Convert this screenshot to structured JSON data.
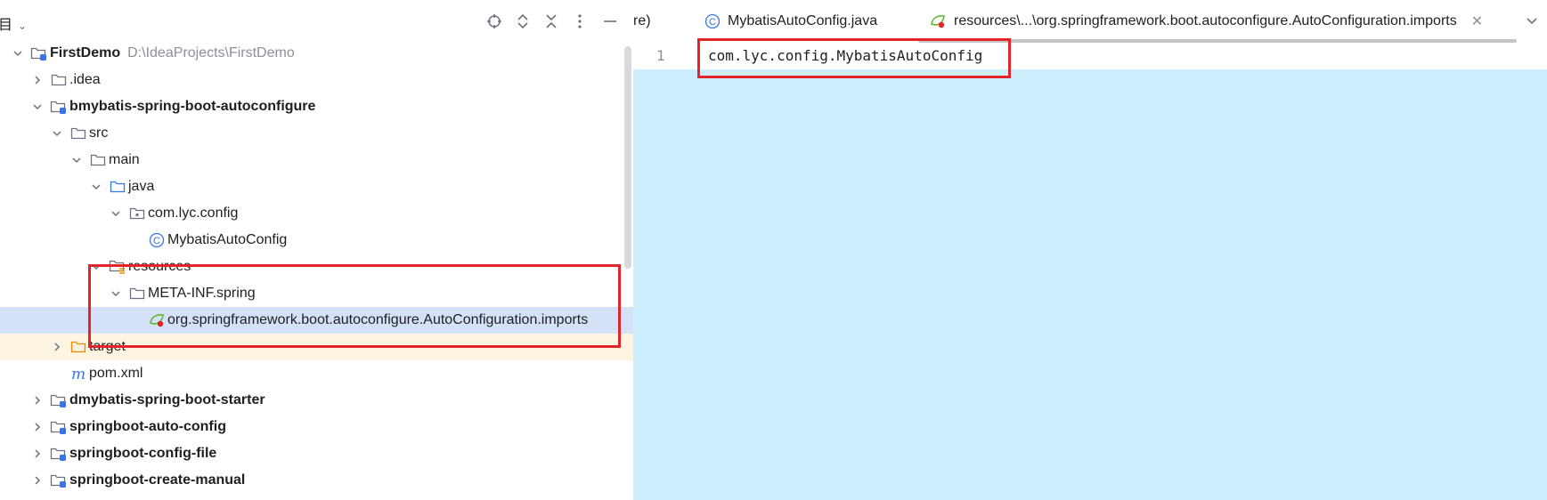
{
  "project_panel": {
    "title": "目",
    "tree": [
      {
        "label": "FirstDemo",
        "path": "D:\\IdeaProjects\\FirstDemo",
        "icon": "module-folder-icon",
        "level": 0,
        "expanded": true
      },
      {
        "label": ".idea",
        "icon": "folder-icon",
        "level": 1,
        "expanded": false
      },
      {
        "label": "bmybatis-spring-boot-autoconfigure",
        "icon": "module-folder-icon",
        "level": 1,
        "expanded": true
      },
      {
        "label": "src",
        "icon": "folder-icon",
        "level": 2,
        "expanded": true
      },
      {
        "label": "main",
        "icon": "folder-icon",
        "level": 3,
        "expanded": true
      },
      {
        "label": "java",
        "icon": "source-folder-icon",
        "level": 4,
        "expanded": true
      },
      {
        "label": "com.lyc.config",
        "icon": "package-icon",
        "level": 5,
        "expanded": true
      },
      {
        "label": "MybatisAutoConfig",
        "icon": "java-class-icon",
        "level": 6
      },
      {
        "label": "resources",
        "icon": "resources-folder-icon",
        "level": 4,
        "expanded": true
      },
      {
        "label": "META-INF.spring",
        "icon": "folder-icon",
        "level": 5,
        "expanded": true
      },
      {
        "label": "org.springframework.boot.autoconfigure.AutoConfiguration.imports",
        "icon": "spring-imports-icon",
        "level": 6,
        "selected": true
      },
      {
        "label": "target",
        "icon": "excluded-folder-icon",
        "level": 2,
        "expanded": false,
        "highlighted": true
      },
      {
        "label": "pom.xml",
        "icon": "maven-icon",
        "level": 2
      },
      {
        "label": "dmybatis-spring-boot-starter",
        "icon": "module-folder-icon",
        "level": 1,
        "expanded": false
      },
      {
        "label": "springboot-auto-config",
        "icon": "module-folder-icon",
        "level": 1,
        "expanded": false
      },
      {
        "label": "springboot-config-file",
        "icon": "module-folder-icon",
        "level": 1,
        "expanded": false
      },
      {
        "label": "springboot-create-manual",
        "icon": "module-folder-icon",
        "level": 1,
        "expanded": false
      }
    ]
  },
  "editor": {
    "tabs": [
      {
        "label": "re)",
        "icon": ""
      },
      {
        "label": "MybatisAutoConfig.java",
        "icon": "java-class-icon"
      },
      {
        "label": "resources\\...\\org.springframework.boot.autoconfigure.AutoConfiguration.imports",
        "icon": "spring-imports-icon",
        "active": true,
        "closable": true
      }
    ],
    "lines": [
      {
        "number": "1",
        "text": "com.lyc.config.MybatisAutoConfig"
      }
    ]
  },
  "colors": {
    "accent_red": "#e3242b",
    "selection": "#d5e1f7",
    "editor_bg": "#cdeefc"
  }
}
